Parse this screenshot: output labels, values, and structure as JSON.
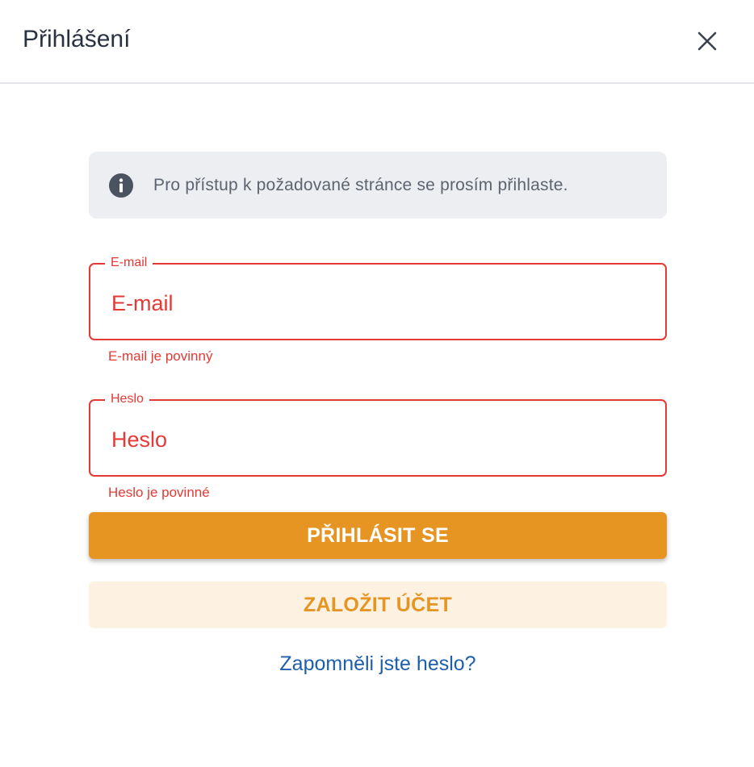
{
  "dialog": {
    "title": "Přihlášení",
    "close_icon": "close-icon"
  },
  "info": {
    "icon": "info-icon",
    "text": "Pro přístup k požadované stránce se prosím přihlaste."
  },
  "email": {
    "label": "E-mail",
    "placeholder": "E-mail",
    "value": "",
    "error": "E-mail je povinný"
  },
  "password": {
    "label": "Heslo",
    "placeholder": "Heslo",
    "value": "",
    "error": "Heslo je povinné"
  },
  "actions": {
    "login_label": "PŘIHLÁSIT SE",
    "register_label": "ZALOŽIT ÚČET",
    "forgot_label": "Zapomněli jste heslo?"
  },
  "colors": {
    "primary": "#e69523",
    "primary_light": "#fdf1e2",
    "error": "#e53935",
    "link": "#1d5fad",
    "info_bg": "#eceef1"
  }
}
